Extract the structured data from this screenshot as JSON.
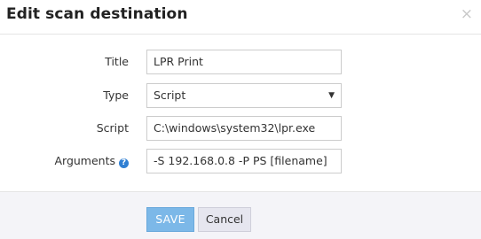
{
  "dialog": {
    "title": "Edit scan destination",
    "close_glyph": "×"
  },
  "form": {
    "title_label": "Title",
    "title_value": "LPR Print",
    "type_label": "Type",
    "type_value": "Script",
    "type_arrow": "▼",
    "script_label": "Script",
    "script_value": "C:\\windows\\system32\\lpr.exe",
    "arguments_label": "Arguments",
    "arguments_help_glyph": "?",
    "arguments_value": "-S 192.168.0.8 -P PS [filename]"
  },
  "footer": {
    "save_label": "SAVE",
    "cancel_label": "Cancel"
  },
  "icons": {
    "close": "close-icon",
    "help": "help-icon",
    "dropdown": "chevron-down-icon"
  },
  "colors": {
    "save_button": "#7cb8e8",
    "help_icon": "#2f7fd3",
    "footer_bg": "#f4f4f8"
  }
}
